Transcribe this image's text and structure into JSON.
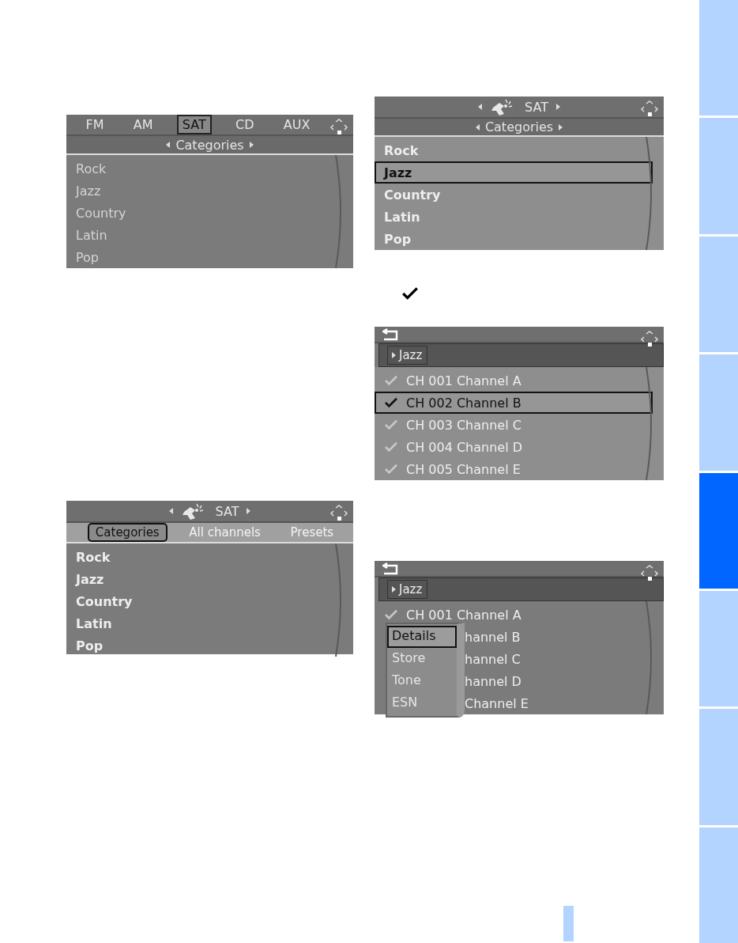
{
  "screens": [
    {
      "top": {
        "kind": "tabs",
        "tabs": [
          {
            "label": "FM",
            "selected": false
          },
          {
            "label": "AM",
            "selected": false
          },
          {
            "label": "SAT",
            "selected": true
          },
          {
            "label": "CD",
            "selected": false
          },
          {
            "label": "AUX",
            "selected": false
          }
        ]
      },
      "sub": {
        "kind": "title",
        "label": "Categories"
      },
      "items": [
        {
          "kind": "plain",
          "label": "Rock",
          "selected": false
        },
        {
          "kind": "plain",
          "label": "Jazz",
          "selected": false
        },
        {
          "kind": "plain",
          "label": "Country",
          "selected": false
        },
        {
          "kind": "plain",
          "label": "Latin",
          "selected": false
        },
        {
          "kind": "plain",
          "label": "Pop",
          "selected": false
        }
      ]
    },
    {
      "top": {
        "kind": "source",
        "label": "SAT"
      },
      "sub": {
        "kind": "title",
        "label": "Categories"
      },
      "items": [
        {
          "kind": "plain",
          "label": "Rock",
          "selected": false
        },
        {
          "kind": "plain",
          "label": "Jazz",
          "selected": true
        },
        {
          "kind": "plain",
          "label": "Country",
          "selected": false
        },
        {
          "kind": "plain",
          "label": "Latin",
          "selected": false
        },
        {
          "kind": "plain",
          "label": "Pop",
          "selected": false
        }
      ]
    },
    {
      "kind": "check"
    },
    {
      "top": {
        "kind": "back"
      },
      "sub": {
        "kind": "crumb",
        "label": "Jazz"
      },
      "items": [
        {
          "kind": "channel",
          "label": "CH 001 Channel A",
          "selected": false
        },
        {
          "kind": "channel",
          "label": "CH 002 Channel B",
          "selected": true
        },
        {
          "kind": "channel",
          "label": "CH 003 Channel C",
          "selected": false
        },
        {
          "kind": "channel",
          "label": "CH 004 Channel D",
          "selected": false
        },
        {
          "kind": "channel",
          "label": "CH 005 Channel E",
          "selected": false
        }
      ]
    },
    {
      "top": {
        "kind": "source",
        "label": "SAT"
      },
      "sub": {
        "kind": "tabs",
        "tabs": [
          {
            "label": "Categories",
            "selected": true
          },
          {
            "label": "All channels",
            "selected": false
          },
          {
            "label": "Presets",
            "selected": false
          }
        ]
      },
      "items": [
        {
          "kind": "plain",
          "label": "Rock",
          "selected": false
        },
        {
          "kind": "plain",
          "label": "Jazz",
          "selected": false
        },
        {
          "kind": "plain",
          "label": "Country",
          "selected": false
        },
        {
          "kind": "plain",
          "label": "Latin",
          "selected": false
        },
        {
          "kind": "plain",
          "label": "Pop",
          "selected": false
        }
      ]
    },
    {
      "top": {
        "kind": "back"
      },
      "sub": {
        "kind": "crumb",
        "label": "Jazz"
      },
      "items": [
        {
          "kind": "channel",
          "label": "CH 001 Channel A",
          "selected": false
        },
        {
          "kind": "partial",
          "label": "hannel B",
          "selected": false
        },
        {
          "kind": "partial",
          "label": "hannel C",
          "selected": false
        },
        {
          "kind": "partial",
          "label": "hannel D",
          "selected": false
        },
        {
          "kind": "partial",
          "label": "Channel E",
          "selected": false
        }
      ],
      "menu": [
        {
          "label": "Details",
          "selected": true
        },
        {
          "label": "Store",
          "selected": false
        },
        {
          "label": "Tone",
          "selected": false
        },
        {
          "label": "ESN",
          "selected": false
        }
      ]
    }
  ],
  "side_tabs": [
    {
      "selected": false
    },
    {
      "selected": false
    },
    {
      "selected": false
    },
    {
      "selected": false
    },
    {
      "selected": true
    },
    {
      "selected": false
    },
    {
      "selected": false
    },
    {
      "selected": false
    }
  ]
}
